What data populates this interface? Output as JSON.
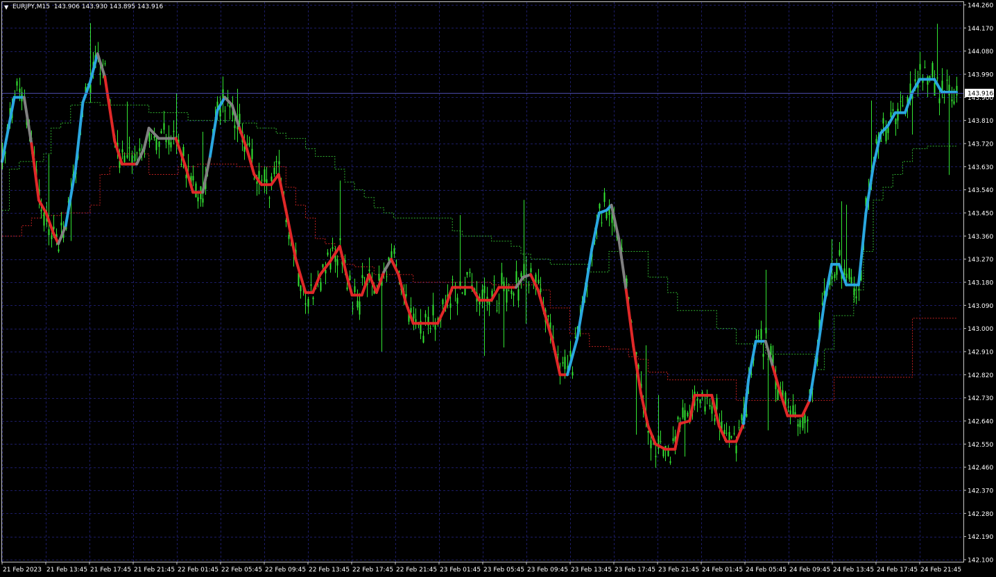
{
  "header": {
    "symbol_text": "EURJPY,M15",
    "ohlc_text": "143.906 143.930 143.895 143.916",
    "menu_triangle": "▼"
  },
  "current_price_label": "143.916",
  "colors": {
    "background": "#000000",
    "grid": "#1c1c66",
    "axis": "#c8c8c8",
    "candles": "#33e633",
    "indicator_up": "#2aa7e0",
    "indicator_down": "#e02828",
    "indicator_flat": "#808080",
    "upper_band": "#2fae2f",
    "lower_band": "#c02020",
    "price_line": "#4a4aa8",
    "price_tag_bg": "#ffffff",
    "price_tag_text": "#000000"
  },
  "chart_data": {
    "type": "line",
    "symbol": "EURJPY",
    "timeframe": "M15",
    "y_ticks": [
      144.26,
      144.17,
      144.08,
      143.99,
      143.9,
      143.81,
      143.72,
      143.63,
      143.54,
      143.45,
      143.36,
      143.27,
      143.18,
      143.09,
      143.0,
      142.91,
      142.82,
      142.73,
      142.64,
      142.55,
      142.46,
      142.37,
      142.28,
      142.19,
      142.1
    ],
    "y_tick_labels": [
      "144.260",
      "144.170",
      "144.080",
      "143.990",
      "143.900",
      "143.810",
      "143.720",
      "143.630",
      "143.540",
      "143.450",
      "143.360",
      "143.270",
      "143.180",
      "143.090",
      "143.000",
      "142.910",
      "142.820",
      "142.730",
      "142.640",
      "142.550",
      "142.460",
      "142.370",
      "142.280",
      "142.190",
      "142.100"
    ],
    "ylim": [
      142.1,
      144.26
    ],
    "x_tick_labels": [
      "21 Feb 2023",
      "21 Feb 13:45",
      "21 Feb 17:45",
      "21 Feb 21:45",
      "22 Feb 01:45",
      "22 Feb 05:45",
      "22 Feb 09:45",
      "22 Feb 13:45",
      "22 Feb 17:45",
      "22 Feb 21:45",
      "23 Feb 01:45",
      "23 Feb 05:45",
      "23 Feb 09:45",
      "23 Feb 13:45",
      "23 Feb 17:45",
      "23 Feb 21:45",
      "24 Feb 01:45",
      "24 Feb 05:45",
      "24 Feb 09:45",
      "24 Feb 13:45",
      "24 Feb 17:45",
      "24 Feb 21:45"
    ],
    "grid": true,
    "current_price": 143.916,
    "indicator_line": [
      [
        0,
        143.65,
        "up"
      ],
      [
        5,
        143.9,
        "up"
      ],
      [
        9,
        143.9,
        "up"
      ],
      [
        12,
        143.72,
        "flat"
      ],
      [
        15,
        143.5,
        "down"
      ],
      [
        18,
        143.45,
        "down"
      ],
      [
        21,
        143.37,
        "down"
      ],
      [
        23,
        143.33,
        "down"
      ],
      [
        26,
        143.4,
        "flat"
      ],
      [
        30,
        143.62,
        "up"
      ],
      [
        33,
        143.88,
        "up"
      ],
      [
        36,
        143.96,
        "up"
      ],
      [
        39,
        144.07,
        "up"
      ],
      [
        42,
        143.98,
        "flat"
      ],
      [
        46,
        143.73,
        "down"
      ],
      [
        49,
        143.64,
        "down"
      ],
      [
        55,
        143.64,
        "down"
      ],
      [
        58,
        143.7,
        "flat"
      ],
      [
        60,
        143.78,
        "flat"
      ],
      [
        64,
        143.74,
        "flat"
      ],
      [
        71,
        143.74,
        "flat"
      ],
      [
        75,
        143.63,
        "down"
      ],
      [
        78,
        143.53,
        "down"
      ],
      [
        82,
        143.53,
        "down"
      ],
      [
        85,
        143.67,
        "flat"
      ],
      [
        88,
        143.85,
        "up"
      ],
      [
        91,
        143.9,
        "up"
      ],
      [
        94,
        143.87,
        "flat"
      ],
      [
        97,
        143.78,
        "flat"
      ],
      [
        100,
        143.7,
        "down"
      ],
      [
        103,
        143.6,
        "down"
      ],
      [
        106,
        143.56,
        "down"
      ],
      [
        110,
        143.56,
        "down"
      ],
      [
        113,
        143.6,
        "down"
      ],
      [
        116,
        143.46,
        "down"
      ],
      [
        120,
        143.27,
        "down"
      ],
      [
        124,
        143.14,
        "down"
      ],
      [
        127,
        143.14,
        "down"
      ],
      [
        130,
        143.21,
        "down"
      ],
      [
        134,
        143.26,
        "down"
      ],
      [
        138,
        143.32,
        "down"
      ],
      [
        141,
        143.2,
        "down"
      ],
      [
        143,
        143.13,
        "down"
      ],
      [
        147,
        143.13,
        "down"
      ],
      [
        150,
        143.21,
        "down"
      ],
      [
        153,
        143.14,
        "down"
      ],
      [
        156,
        143.22,
        "down"
      ],
      [
        159,
        143.27,
        "flat"
      ],
      [
        162,
        143.21,
        "down"
      ],
      [
        165,
        143.1,
        "down"
      ],
      [
        168,
        143.02,
        "down"
      ],
      [
        178,
        143.02,
        "down"
      ],
      [
        181,
        143.08,
        "down"
      ],
      [
        184,
        143.16,
        "down"
      ],
      [
        192,
        143.16,
        "down"
      ],
      [
        195,
        143.11,
        "down"
      ],
      [
        200,
        143.11,
        "down"
      ],
      [
        203,
        143.16,
        "down"
      ],
      [
        210,
        143.16,
        "down"
      ],
      [
        213,
        143.2,
        "flat"
      ],
      [
        216,
        143.21,
        "flat"
      ],
      [
        219,
        143.15,
        "down"
      ],
      [
        222,
        143.05,
        "down"
      ],
      [
        225,
        142.95,
        "down"
      ],
      [
        228,
        142.82,
        "down"
      ],
      [
        231,
        142.82,
        "down"
      ],
      [
        235,
        142.96,
        "up"
      ],
      [
        238,
        143.13,
        "up"
      ],
      [
        241,
        143.31,
        "up"
      ],
      [
        244,
        143.45,
        "up"
      ],
      [
        247,
        143.46,
        "up"
      ],
      [
        249,
        143.48,
        "up"
      ],
      [
        252,
        143.35,
        "flat"
      ],
      [
        255,
        143.15,
        "flat"
      ],
      [
        258,
        142.93,
        "down"
      ],
      [
        261,
        142.75,
        "down"
      ],
      [
        264,
        142.62,
        "down"
      ],
      [
        267,
        142.55,
        "down"
      ],
      [
        271,
        142.53,
        "down"
      ],
      [
        275,
        142.53,
        "down"
      ],
      [
        277,
        142.63,
        "down"
      ],
      [
        281,
        142.64,
        "down"
      ],
      [
        283,
        142.74,
        "down"
      ],
      [
        290,
        142.74,
        "down"
      ],
      [
        293,
        142.62,
        "down"
      ],
      [
        296,
        142.56,
        "down"
      ],
      [
        300,
        142.56,
        "down"
      ],
      [
        303,
        142.63,
        "down"
      ],
      [
        305,
        142.8,
        "up"
      ],
      [
        308,
        142.95,
        "up"
      ],
      [
        312,
        142.95,
        "up"
      ],
      [
        315,
        142.85,
        "flat"
      ],
      [
        318,
        142.75,
        "down"
      ],
      [
        321,
        142.66,
        "down"
      ],
      [
        327,
        142.66,
        "down"
      ],
      [
        330,
        142.72,
        "down"
      ],
      [
        333,
        142.9,
        "up"
      ],
      [
        336,
        143.1,
        "up"
      ],
      [
        339,
        143.25,
        "up"
      ],
      [
        342,
        143.25,
        "up"
      ],
      [
        345,
        143.17,
        "up"
      ],
      [
        350,
        143.17,
        "up"
      ],
      [
        353,
        143.45,
        "up"
      ],
      [
        356,
        143.63,
        "up"
      ],
      [
        359,
        143.76,
        "up"
      ],
      [
        362,
        143.79,
        "up"
      ],
      [
        365,
        143.84,
        "up"
      ],
      [
        369,
        143.84,
        "up"
      ],
      [
        372,
        143.92,
        "up"
      ],
      [
        375,
        143.97,
        "up"
      ],
      [
        381,
        143.97,
        "up"
      ],
      [
        384,
        143.92,
        "up"
      ],
      [
        390,
        143.92,
        "up"
      ]
    ],
    "upper_band": [
      [
        0,
        143.46
      ],
      [
        3,
        143.62
      ],
      [
        7,
        143.65
      ],
      [
        13,
        143.65
      ],
      [
        17,
        143.68
      ],
      [
        20,
        143.78
      ],
      [
        24,
        143.8
      ],
      [
        28,
        143.87
      ],
      [
        32,
        143.88
      ],
      [
        36,
        143.88
      ],
      [
        40,
        143.87
      ],
      [
        44,
        143.87
      ],
      [
        48,
        143.87
      ],
      [
        56,
        143.87
      ],
      [
        60,
        143.84
      ],
      [
        72,
        143.84
      ],
      [
        76,
        143.81
      ],
      [
        88,
        143.81
      ],
      [
        96,
        143.8
      ],
      [
        104,
        143.78
      ],
      [
        112,
        143.76
      ],
      [
        116,
        143.74
      ],
      [
        124,
        143.7
      ],
      [
        128,
        143.67
      ],
      [
        136,
        143.62
      ],
      [
        140,
        143.57
      ],
      [
        144,
        143.54
      ],
      [
        148,
        143.51
      ],
      [
        152,
        143.47
      ],
      [
        156,
        143.45
      ],
      [
        160,
        143.43
      ],
      [
        168,
        143.43
      ],
      [
        180,
        143.43
      ],
      [
        184,
        143.38
      ],
      [
        188,
        143.36
      ],
      [
        196,
        143.36
      ],
      [
        200,
        143.34
      ],
      [
        208,
        143.32
      ],
      [
        212,
        143.29
      ],
      [
        216,
        143.27
      ],
      [
        224,
        143.25
      ],
      [
        232,
        143.25
      ],
      [
        240,
        143.22
      ],
      [
        248,
        143.3
      ],
      [
        256,
        143.3
      ],
      [
        260,
        143.3
      ],
      [
        264,
        143.2
      ],
      [
        272,
        143.14
      ],
      [
        276,
        143.07
      ],
      [
        284,
        143.07
      ],
      [
        292,
        143.0
      ],
      [
        300,
        142.94
      ],
      [
        312,
        142.9
      ],
      [
        320,
        142.9
      ],
      [
        332,
        142.84
      ],
      [
        336,
        142.92
      ],
      [
        340,
        143.05
      ],
      [
        344,
        143.05
      ],
      [
        348,
        143.15
      ],
      [
        352,
        143.3
      ],
      [
        356,
        143.5
      ],
      [
        360,
        143.55
      ],
      [
        364,
        143.6
      ],
      [
        368,
        143.65
      ],
      [
        372,
        143.7
      ],
      [
        378,
        143.71
      ],
      [
        390,
        143.71
      ]
    ],
    "lower_band": [
      [
        0,
        143.36
      ],
      [
        4,
        143.36
      ],
      [
        8,
        143.4
      ],
      [
        12,
        143.43
      ],
      [
        16,
        143.44
      ],
      [
        24,
        143.45
      ],
      [
        32,
        143.45
      ],
      [
        36,
        143.48
      ],
      [
        40,
        143.6
      ],
      [
        44,
        143.63
      ],
      [
        48,
        143.68
      ],
      [
        56,
        143.68
      ],
      [
        60,
        143.6
      ],
      [
        68,
        143.6
      ],
      [
        72,
        143.63
      ],
      [
        80,
        143.64
      ],
      [
        88,
        143.64
      ],
      [
        96,
        143.63
      ],
      [
        104,
        143.63
      ],
      [
        110,
        143.63
      ],
      [
        116,
        143.55
      ],
      [
        120,
        143.48
      ],
      [
        124,
        143.43
      ],
      [
        128,
        143.35
      ],
      [
        132,
        143.33
      ],
      [
        136,
        143.28
      ],
      [
        140,
        143.25
      ],
      [
        144,
        143.24
      ],
      [
        152,
        143.21
      ],
      [
        160,
        143.21
      ],
      [
        168,
        143.18
      ],
      [
        176,
        143.18
      ],
      [
        184,
        143.18
      ],
      [
        192,
        143.18
      ],
      [
        200,
        143.17
      ],
      [
        208,
        143.17
      ],
      [
        216,
        143.17
      ],
      [
        220,
        143.15
      ],
      [
        224,
        143.08
      ],
      [
        232,
        142.98
      ],
      [
        240,
        142.93
      ],
      [
        248,
        142.92
      ],
      [
        256,
        142.89
      ],
      [
        260,
        142.88
      ],
      [
        264,
        142.83
      ],
      [
        272,
        142.8
      ],
      [
        280,
        142.8
      ],
      [
        292,
        142.8
      ],
      [
        300,
        142.72
      ],
      [
        320,
        142.72
      ],
      [
        336,
        142.72
      ],
      [
        340,
        142.81
      ],
      [
        344,
        142.81
      ],
      [
        368,
        142.81
      ],
      [
        372,
        143.04
      ],
      [
        377,
        143.04
      ],
      [
        390,
        143.04
      ]
    ]
  }
}
